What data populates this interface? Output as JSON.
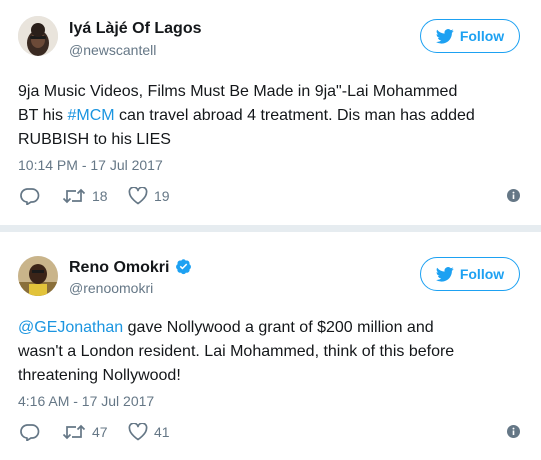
{
  "tweets": [
    {
      "name": "Iyá Làjé Of Lagos",
      "handle": "@newscantell",
      "verified": false,
      "follow_label": "Follow",
      "text_line1": "9ja Music Videos, Films Must Be Made in 9ja\"-Lai Mohammed",
      "text_line2_pre": "BT his ",
      "text_line2_link": "#MCM",
      "text_line2_post": " can travel abroad 4 treatment. Dis man has added",
      "text_line3": "RUBBISH to his LIES",
      "timestamp": "10:14 PM - 17 Jul 2017",
      "retweets": "18",
      "likes": "19"
    },
    {
      "name": "Reno Omokri",
      "handle": "@renoomokri",
      "verified": true,
      "follow_label": "Follow",
      "text_line1_link": "@GEJonathan",
      "text_line1_post": " gave Nollywood a grant of $200 million and",
      "text_line2": "wasn't a London resident. Lai Mohammed, think of this before",
      "text_line3": "threatening Nollywood!",
      "timestamp": "4:16 AM - 17 Jul 2017",
      "retweets": "47",
      "likes": "41"
    }
  ],
  "icons": {
    "reply": "reply-icon",
    "retweet": "retweet-icon",
    "like": "heart-icon",
    "info": "info-icon",
    "follow": "twitter-bird-icon",
    "verified": "verified-badge-icon"
  },
  "colors": {
    "accent": "#1da1f2",
    "link": "#1b95e0",
    "muted": "#657786",
    "text": "#14171a",
    "divider": "#e6ecf0"
  }
}
